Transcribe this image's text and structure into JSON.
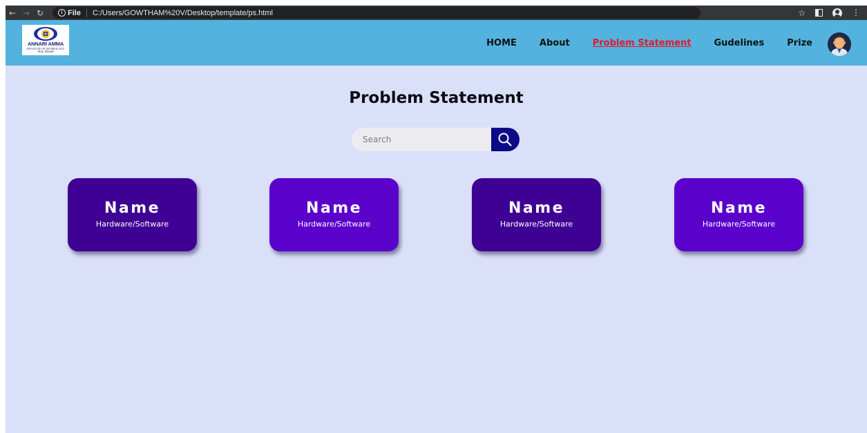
{
  "browser": {
    "scheme_label": "File",
    "url": "C:/Users/GOWTHAM%20V/Desktop/template/ps.html",
    "icons": [
      "back-icon",
      "forward-icon",
      "reload-icon",
      "info-icon",
      "star-icon",
      "side-panel-icon",
      "profile-icon",
      "menu-icon"
    ]
  },
  "logo": {
    "name": "ANNARI AMMA",
    "subtitle": "INSTITUTE OF TECHNOLOGY",
    "tagline": "Stay Ahead"
  },
  "nav": {
    "items": [
      {
        "label": "HOME"
      },
      {
        "label": "About"
      },
      {
        "label": "Problem Statement",
        "active": true
      },
      {
        "label": "Gudelines"
      },
      {
        "label": "Prize"
      }
    ],
    "active_color": "#e3172a",
    "bar_color": "#53b3de"
  },
  "main": {
    "title": "Problem Statement",
    "search": {
      "placeholder": "Search"
    },
    "cards": [
      {
        "name": "Name",
        "type": "Hardware/Software",
        "color": "#3f0194"
      },
      {
        "name": "Name",
        "type": "Hardware/Software",
        "color": "#5a02cb"
      },
      {
        "name": "Name",
        "type": "Hardware/Software",
        "color": "#3f0194"
      },
      {
        "name": "Name",
        "type": "Hardware/Software",
        "color": "#5a02cb"
      }
    ],
    "background": "#dbe0f9",
    "search_button_color": "#0d0a86"
  }
}
